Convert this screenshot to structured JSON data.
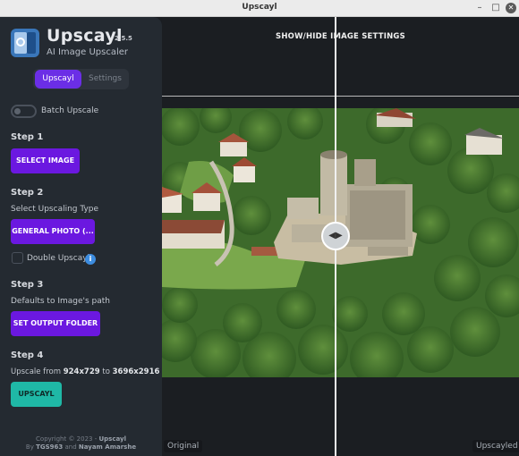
{
  "window": {
    "title": "Upscayl"
  },
  "brand": {
    "name": "Upscayl",
    "version": "2.5.5",
    "tagline": "AI Image Upscaler"
  },
  "tabs": [
    {
      "label": "Upscayl",
      "active": true
    },
    {
      "label": "Settings",
      "active": false
    }
  ],
  "batch": {
    "label": "Batch Upscale",
    "enabled": false
  },
  "step1": {
    "title": "Step 1",
    "button": "SELECT IMAGE"
  },
  "step2": {
    "title": "Step 2",
    "subtitle": "Select Upscaling Type",
    "button": "GENERAL PHOTO (...",
    "double_label": "Double Upscayl",
    "double_checked": false,
    "info_glyph": "i"
  },
  "step3": {
    "title": "Step 3",
    "subtitle": "Defaults to Image's path",
    "button": "SET OUTPUT FOLDER"
  },
  "step4": {
    "title": "Step 4",
    "text_prefix": "Upscale from ",
    "from": "924x729",
    "text_mid": " to ",
    "to": "3696x2916",
    "button": "UPSCAYL"
  },
  "footer": {
    "copyright_prefix": "Copyright © 2023 - ",
    "copyright_name": "Upscayl",
    "by_prefix": "By ",
    "author1": "TGS963",
    "and": " and ",
    "author2": "Nayam Amarshe"
  },
  "main": {
    "settings_link": "SHOW/HIDE IMAGE SETTINGS",
    "label_left": "Original",
    "label_right": "Upscayled",
    "slider_position_percent": 48.6
  },
  "colors": {
    "accent_purple": "#6b18e0",
    "accent_teal": "#1fb8a6",
    "sidebar_bg": "#242a31",
    "info_blue": "#3d8de0"
  },
  "icons": {
    "logo": "upscayl-logo",
    "info": "info-icon",
    "slider_handle": "compare-handle-icon",
    "minimize": "minimize-icon",
    "maximize": "maximize-icon",
    "close": "close-icon"
  }
}
